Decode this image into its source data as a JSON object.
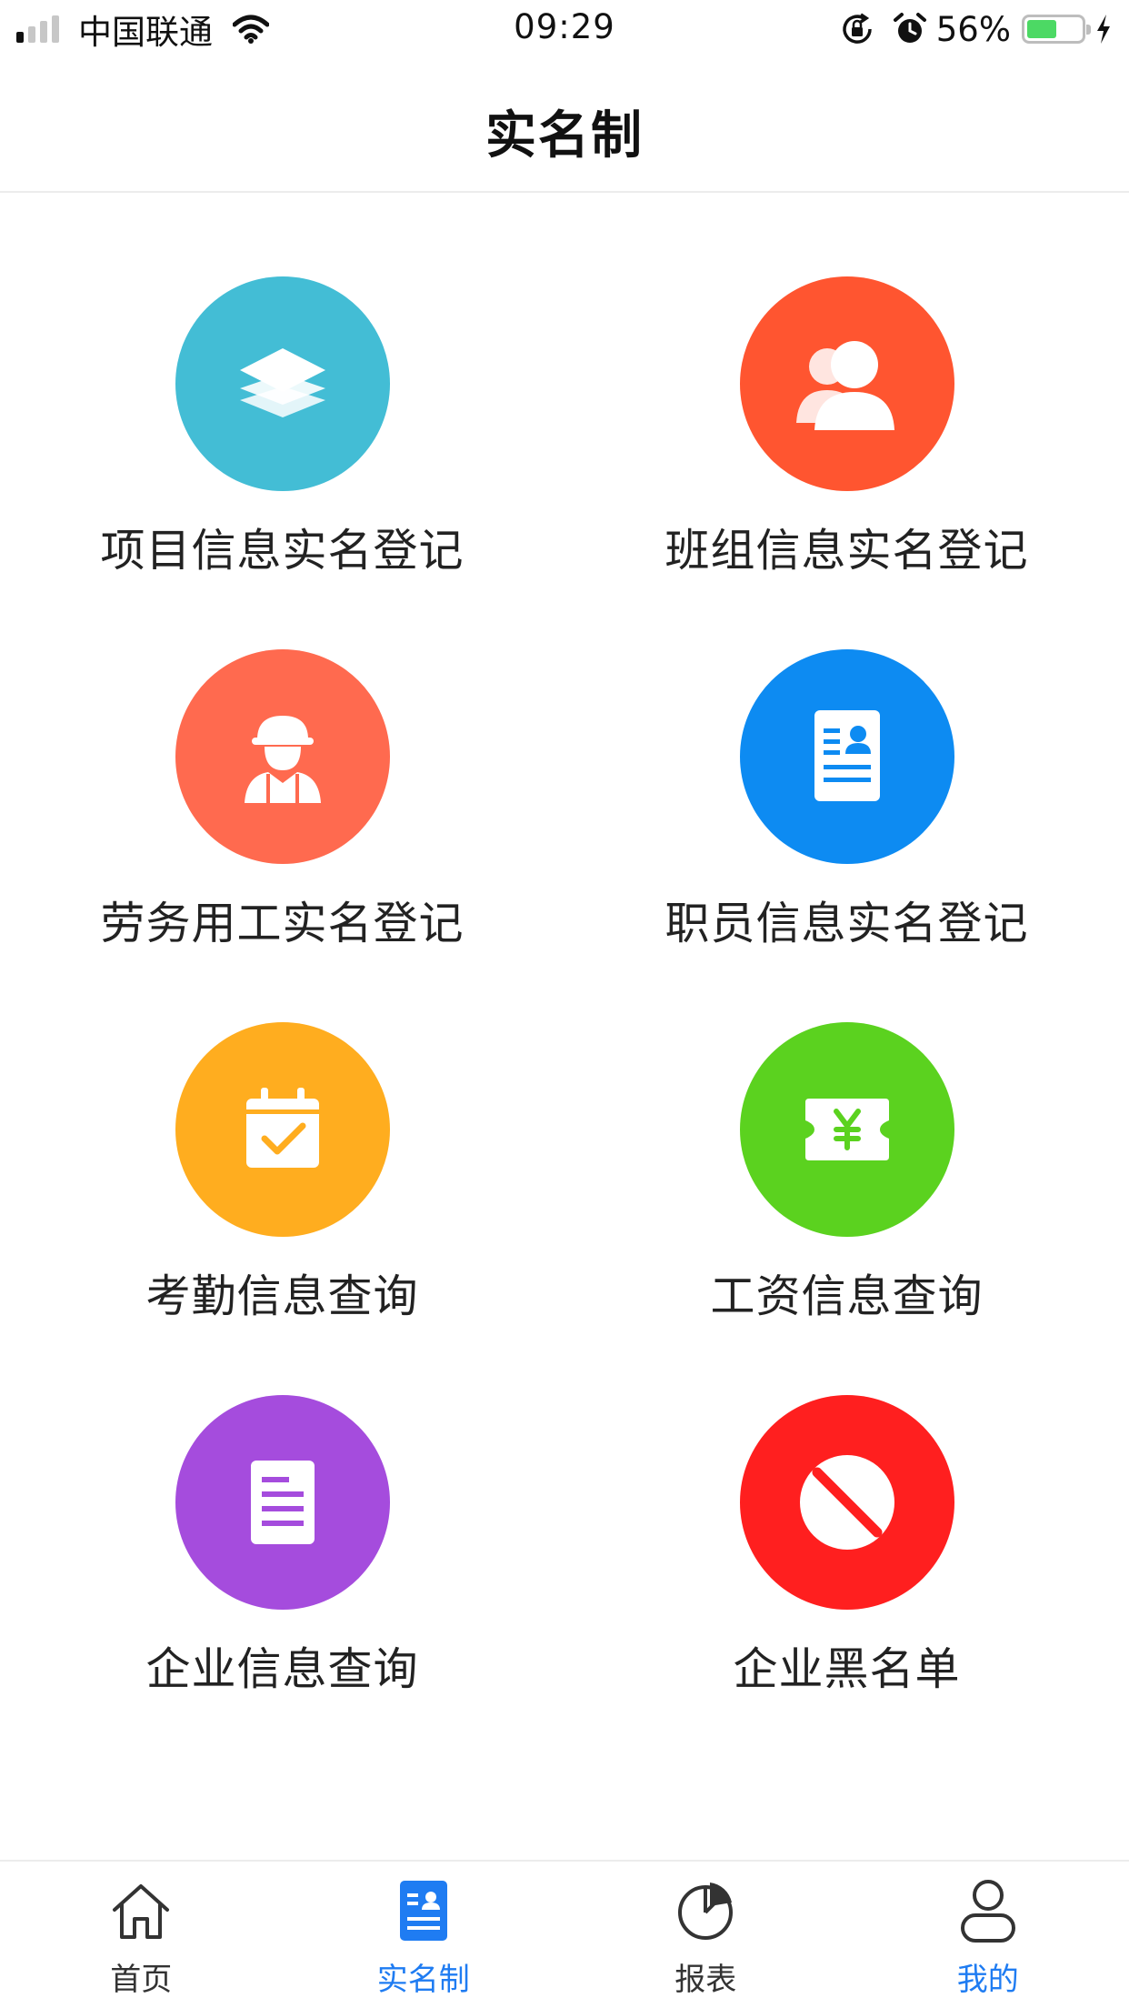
{
  "status_bar": {
    "carrier": "中国联通",
    "time": "09:29",
    "battery_percent": "56%",
    "battery_level": 0.56,
    "signal_bars_on": 1,
    "signal_bars_total": 4,
    "icons": [
      "signal-bars-icon",
      "wifi-icon",
      "rotation-lock-icon",
      "alarm-clock-icon",
      "battery-icon",
      "charging-bolt-icon"
    ]
  },
  "nav": {
    "title": "实名制"
  },
  "grid": {
    "items": [
      {
        "label": "项目信息实名登记",
        "icon": "stacked-layers-icon",
        "color": "#43bdd5"
      },
      {
        "label": "班组信息实名登记",
        "icon": "user-group-icon",
        "color": "#ff5530"
      },
      {
        "label": "劳务用工实名登记",
        "icon": "construction-worker-icon",
        "color": "#ff6a4f"
      },
      {
        "label": "职员信息实名登记",
        "icon": "employee-card-icon",
        "color": "#0d8bf2"
      },
      {
        "label": "考勤信息查询",
        "icon": "calendar-check-icon",
        "color": "#ffad1f"
      },
      {
        "label": "工资信息查询",
        "icon": "yen-ticket-icon",
        "color": "#5bd21f"
      },
      {
        "label": "企业信息查询",
        "icon": "document-list-icon",
        "color": "#a54cdd"
      },
      {
        "label": "企业黑名单",
        "icon": "prohibited-icon",
        "color": "#ff1f1f"
      }
    ]
  },
  "tab_bar": {
    "active_color": "#1f7cf2",
    "inactive_color": "#333333",
    "items": [
      {
        "label": "首页",
        "icon": "home-icon",
        "label_active": false,
        "icon_active": false
      },
      {
        "label": "实名制",
        "icon": "id-card-icon",
        "label_active": true,
        "icon_active": true
      },
      {
        "label": "报表",
        "icon": "pie-chart-icon",
        "label_active": false,
        "icon_active": false
      },
      {
        "label": "我的",
        "icon": "user-profile-icon",
        "label_active": true,
        "icon_active": false
      }
    ]
  }
}
